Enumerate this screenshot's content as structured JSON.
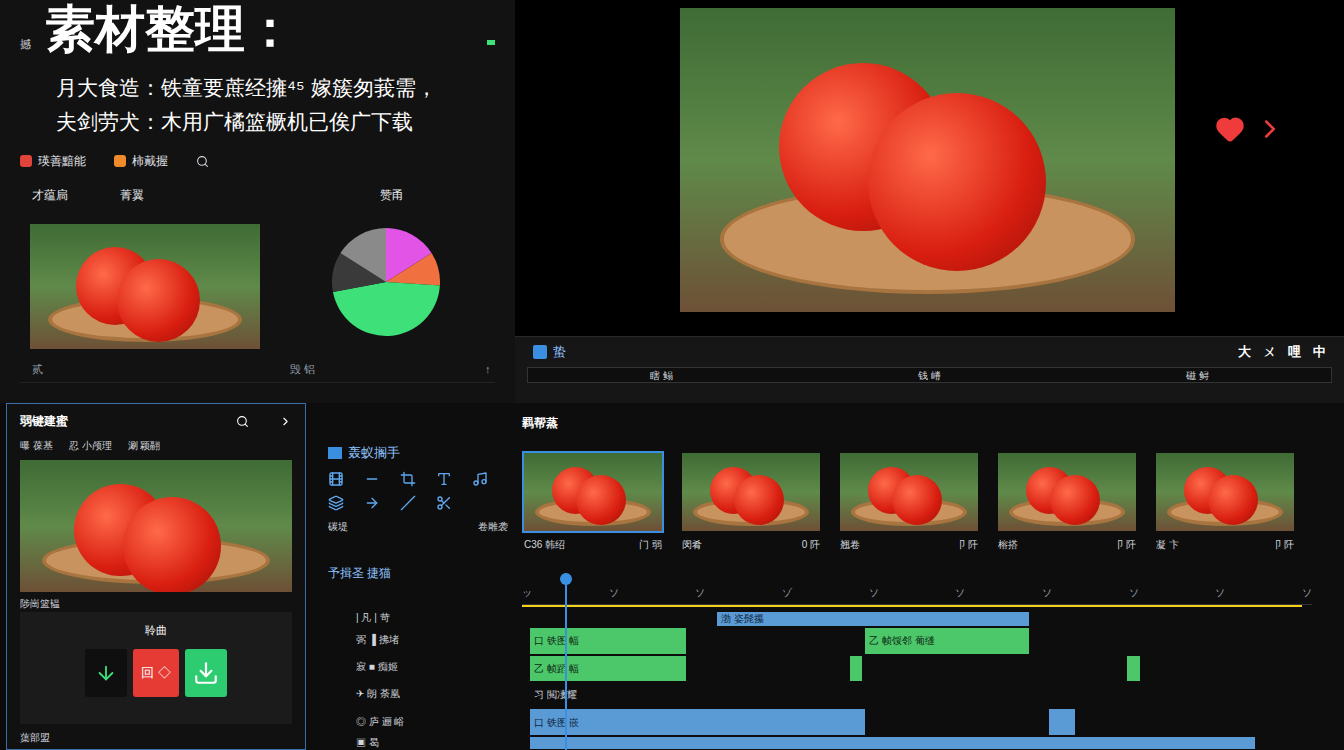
{
  "header": {
    "badge": "撼",
    "title": "素材整理：",
    "lines": [
      "月大食造：铁童要蔗经擁⁴⁵ 嫁簇匆莪需，",
      "夫剑劳犬：木用广橘篮橛机已俟广下载"
    ]
  },
  "toolbar": [
    {
      "label": "瑛善黯能",
      "color": "#e0443a"
    },
    {
      "label": "柿戴握",
      "color": "#f08a2a"
    }
  ],
  "asset_panel": {
    "columns": [
      "才蕴扃",
      "菁翼",
      "赞甬"
    ],
    "footer": [
      "贰",
      "毁 铝",
      "↑"
    ]
  },
  "pie": {
    "segments": [
      {
        "value": 16,
        "color": "#e254e6"
      },
      {
        "value": 10,
        "color": "#f07040"
      },
      {
        "value": 46,
        "color": "#3ee07a"
      },
      {
        "value": 12,
        "color": "#3a3a3a"
      },
      {
        "value": 16,
        "color": "#8a8a8a"
      }
    ]
  },
  "transport": {
    "label": "蛰",
    "controls": [
      "大",
      "ㄨ",
      "哩",
      "中"
    ],
    "marks": [
      "瞎 鳎",
      "钱 嵴",
      "磁 鲟"
    ]
  },
  "library": {
    "title": "弱键建蜜",
    "tabs": [
      "曝 葆基",
      "忍 小颅理",
      "涮 颖翮"
    ],
    "section": "陟崗篮韫",
    "dialog": {
      "title": "聆曲",
      "buttons": [
        {
          "kind": "down",
          "color": "#0f0f0f"
        },
        {
          "kind": "clip",
          "label": "回 ◇",
          "color": "#e63b35"
        },
        {
          "kind": "download",
          "color": "#2ecc71"
        }
      ]
    },
    "footer": "蕖部盟"
  },
  "timeline": {
    "title": "羁帮蒸",
    "tools": {
      "title": "轰蚁搁手",
      "labels": [
        "碳堤",
        "卷雕袭"
      ]
    },
    "clips": [
      {
        "name": "C36 韩绍",
        "meta": "门 弱",
        "selected": true
      },
      {
        "name": "闵肴",
        "meta": "0 阡",
        "selected": false
      },
      {
        "name": "翘卷",
        "meta": "卩 阡",
        "selected": false
      },
      {
        "name": "榕搭",
        "meta": "卩 阡",
        "selected": false
      },
      {
        "name": "凝 卞",
        "meta": "卩 阡",
        "selected": false
      }
    ],
    "tracks_label": "予揖圣 捷猫",
    "ruler": [
      "ッ",
      "ソ",
      "ソ",
      "ゾ",
      "ソ",
      "ソ",
      "ソ",
      "ソ",
      "ソ",
      "ソ"
    ],
    "playhead": 0.055,
    "tracks": [
      {
        "label": "| 凡 | 苛",
        "clips": [
          {
            "start": 25,
            "length": 40,
            "kind": "video",
            "text": "渤 姿髭攥"
          }
        ]
      },
      {
        "label": "弼 ▐ 拂堵",
        "clips": [
          {
            "start": 1,
            "length": 20,
            "kind": "audio",
            "text": "口 铁图 幅"
          },
          {
            "start": 44,
            "length": 21,
            "kind": "audio",
            "text": "乙 帧馁邻 葡缝"
          }
        ]
      },
      {
        "label": "寂 ■ 痴姬",
        "clips": [
          {
            "start": 1,
            "length": 20,
            "kind": "audio",
            "text": "乙 帧蹈 幅"
          },
          {
            "start": 42,
            "length": 1.6,
            "kind": "audio",
            "text": ""
          },
          {
            "start": 77.5,
            "length": 1.7,
            "kind": "audio",
            "text": ""
          }
        ]
      },
      {
        "label": "✈ 朗 荼凰",
        "clips": [
          {
            "start": 1,
            "length": 20,
            "kind": "text",
            "text": "习 閲凄耀"
          }
        ]
      },
      {
        "label": "◎ 庐 逦 峪",
        "clips": [
          {
            "start": 1,
            "length": 43,
            "kind": "video",
            "text": "口 铁图 嵌"
          },
          {
            "start": 67.5,
            "length": 3.4,
            "kind": "video",
            "text": ""
          }
        ]
      },
      {
        "label": "▣ 曷",
        "clips": [
          {
            "start": 1,
            "length": 43,
            "kind": "video",
            "text": ""
          },
          {
            "start": 44,
            "length": 27,
            "kind": "video",
            "text": ""
          },
          {
            "start": 71,
            "length": 23,
            "kind": "video",
            "text": ""
          }
        ]
      }
    ]
  }
}
